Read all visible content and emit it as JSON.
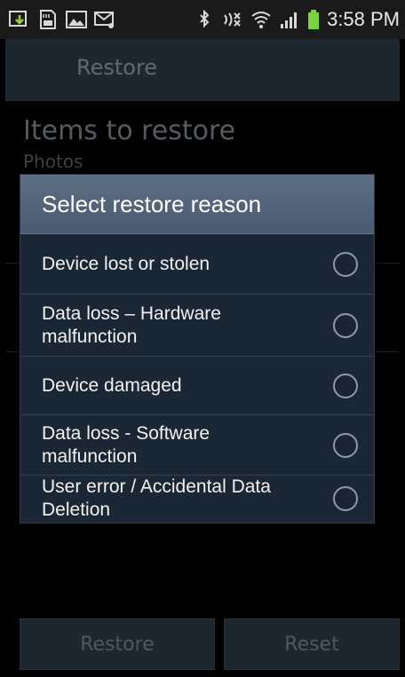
{
  "status_bar": {
    "time": "3:58 PM",
    "left_icons": [
      "download-icon",
      "sd-card-icon",
      "image-icon",
      "sms-icon"
    ],
    "right_icons": [
      "bluetooth-icon",
      "nfc-icon",
      "wifi-icon",
      "signal-icon",
      "battery-icon"
    ]
  },
  "action_bar": {
    "title": "Restore"
  },
  "background": {
    "items_title": "Items to restore",
    "items_value": "Photos"
  },
  "dialog": {
    "title": "Select restore reason",
    "options": [
      {
        "label": "Device lost or stolen",
        "selected": false
      },
      {
        "label": "Data loss – Hardware malfunction",
        "selected": false
      },
      {
        "label": "Device damaged",
        "selected": false
      },
      {
        "label": "Data loss - Software malfunction",
        "selected": false
      },
      {
        "label": "User error / Accidental Data Deletion",
        "selected": false
      }
    ]
  },
  "buttons": {
    "restore": "Restore",
    "reset": "Reset"
  },
  "colors": {
    "dialog_bg": "#1c2735",
    "dialog_title_bg": "#5e6f84",
    "battery": "#7bd23a"
  }
}
